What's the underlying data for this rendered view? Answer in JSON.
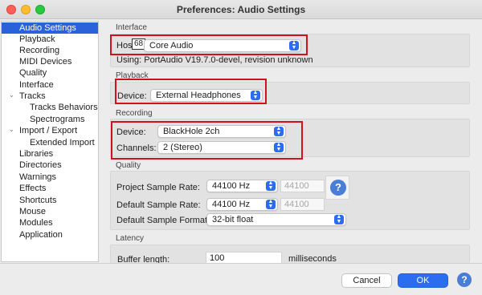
{
  "window": {
    "title": "Preferences: Audio Settings"
  },
  "sidebar": {
    "items": [
      {
        "label": "Audio Settings"
      },
      {
        "label": "Playback"
      },
      {
        "label": "Recording"
      },
      {
        "label": "MIDI Devices"
      },
      {
        "label": "Quality"
      },
      {
        "label": "Interface"
      },
      {
        "label": "Tracks"
      },
      {
        "label": "Tracks Behaviors"
      },
      {
        "label": "Spectrograms"
      },
      {
        "label": "Import / Export"
      },
      {
        "label": "Extended Import"
      },
      {
        "label": "Libraries"
      },
      {
        "label": "Directories"
      },
      {
        "label": "Warnings"
      },
      {
        "label": "Effects"
      },
      {
        "label": "Shortcuts"
      },
      {
        "label": "Mouse"
      },
      {
        "label": "Modules"
      },
      {
        "label": "Application"
      }
    ],
    "selected": "Audio Settings"
  },
  "interface": {
    "section": "Interface",
    "host_label": "Hos",
    "host_tooltip": "68",
    "host_value": "Core Audio",
    "using_text": "Using:  PortAudio V19.7.0-devel, revision unknown"
  },
  "playback": {
    "section": "Playback",
    "device_label": "Device:",
    "device_value": "External Headphones"
  },
  "recording": {
    "section": "Recording",
    "device_label": "Device:",
    "device_value": "BlackHole 2ch",
    "channels_label": "Channels:",
    "channels_value": "2 (Stereo)"
  },
  "quality": {
    "section": "Quality",
    "project_rate_label": "Project Sample Rate:",
    "project_rate_value": "44100 Hz",
    "project_rate_text": "44100",
    "default_rate_label": "Default Sample Rate:",
    "default_rate_value": "44100 Hz",
    "default_rate_text": "44100",
    "default_format_label": "Default Sample Format:",
    "default_format_value": "32-bit float"
  },
  "latency": {
    "section": "Latency",
    "buffer_label": "Buffer length:",
    "buffer_value": "100",
    "buffer_unit": "milliseconds"
  },
  "footer": {
    "cancel_label": "Cancel",
    "ok_label": "OK",
    "help_glyph": "?"
  },
  "colors": {
    "accent": "#2a6df0",
    "highlight_box": "#d3101d",
    "selection": "#2962d9"
  }
}
